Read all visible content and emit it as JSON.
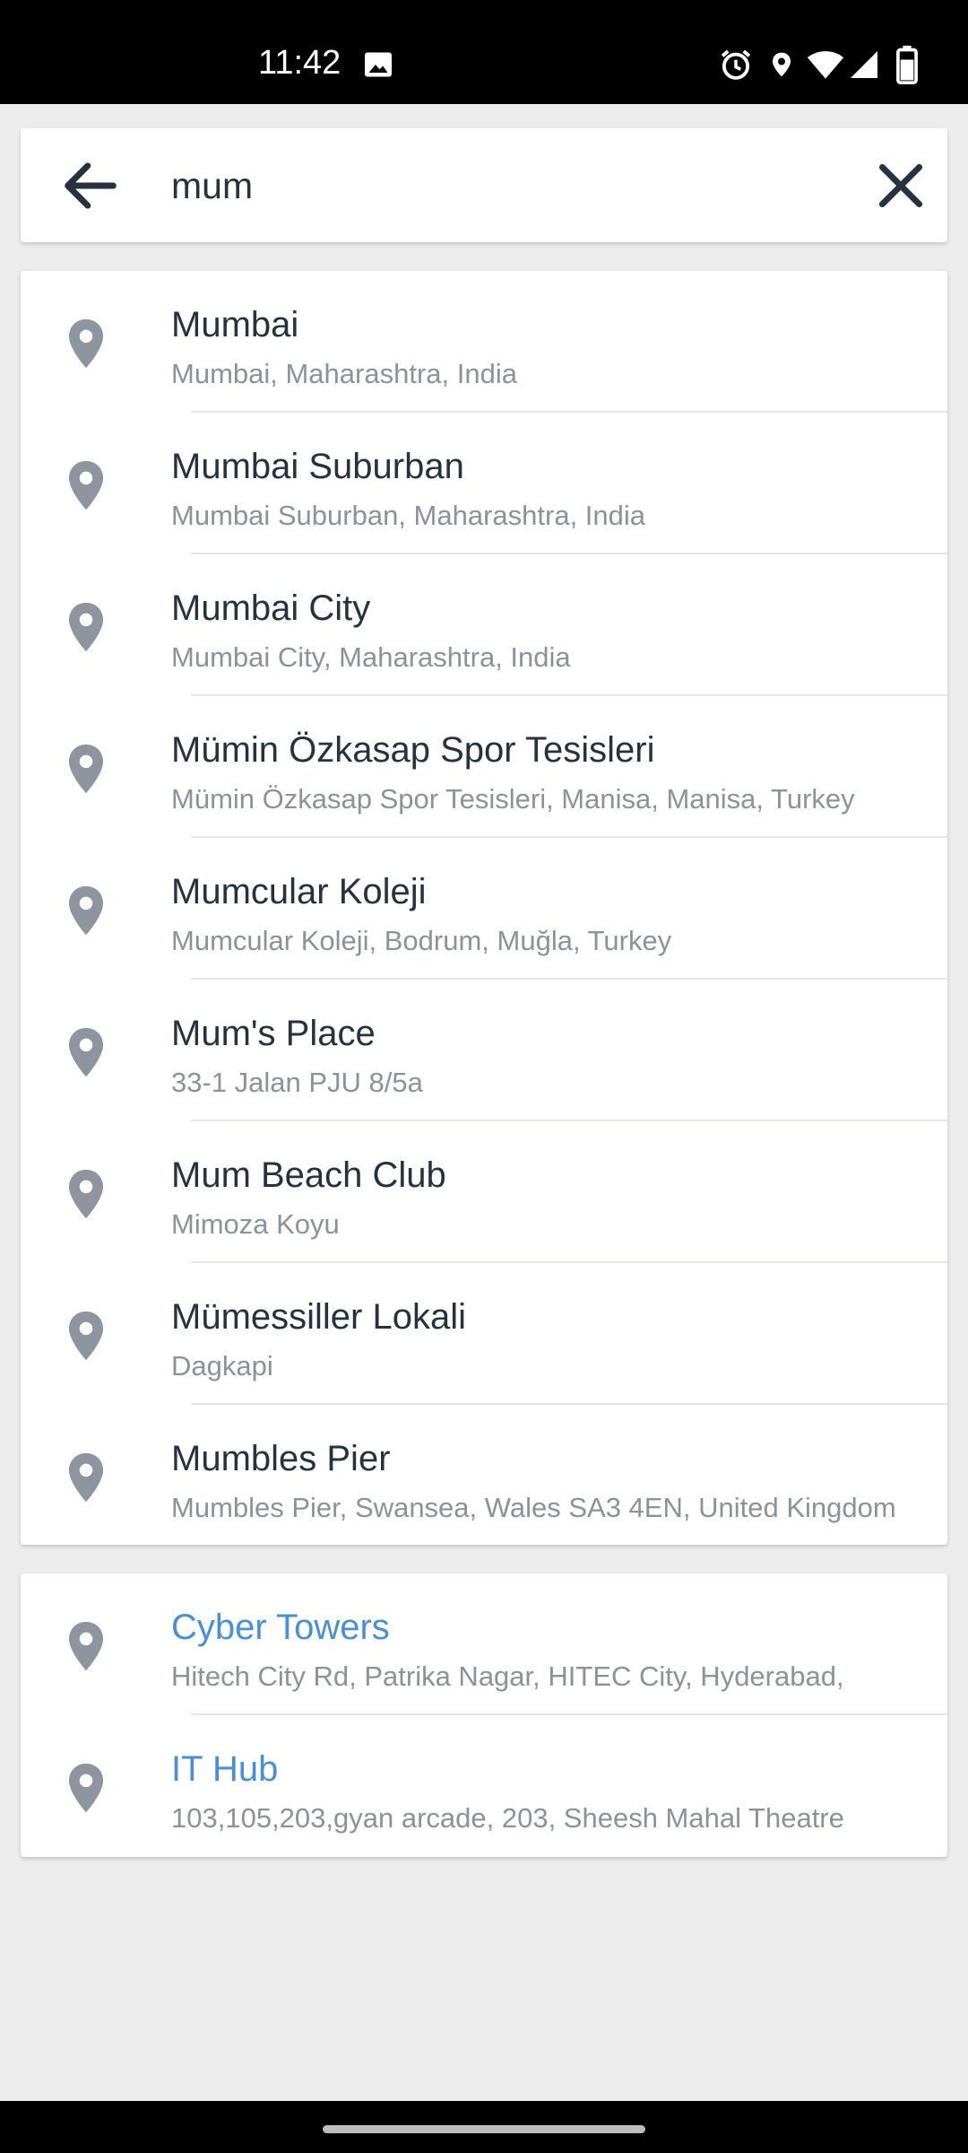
{
  "status_bar": {
    "time": "11:42",
    "icons": [
      "image-icon",
      "alarm-icon",
      "location-icon",
      "wifi-icon",
      "signal-icon",
      "battery-icon"
    ]
  },
  "search": {
    "value": "mum",
    "back_icon": "arrow-left-icon",
    "clear_icon": "close-icon"
  },
  "results": [
    {
      "title": "Mumbai",
      "subtitle": "Mumbai, Maharashtra, India"
    },
    {
      "title": "Mumbai Suburban",
      "subtitle": "Mumbai Suburban, Maharashtra, India"
    },
    {
      "title": "Mumbai City",
      "subtitle": "Mumbai City, Maharashtra, India"
    },
    {
      "title": "Mümin Özkasap Spor Tesisleri",
      "subtitle": "Mümin Özkasap Spor Tesisleri, Manisa, Manisa, Turkey"
    },
    {
      "title": "Mumcular Koleji",
      "subtitle": "Mumcular Koleji, Bodrum, Muğla, Turkey"
    },
    {
      "title": "Mum's Place",
      "subtitle": "33-1 Jalan PJU 8/5a"
    },
    {
      "title": "Mum Beach Club",
      "subtitle": "Mimoza Koyu"
    },
    {
      "title": "Mümessiller Lokali",
      "subtitle": "Dagkapi"
    },
    {
      "title": "Mumbles Pier",
      "subtitle": "Mumbles Pier, Swansea, Wales SA3 4EN, United Kingdom"
    }
  ],
  "recent": [
    {
      "title": "Cyber Towers",
      "subtitle": "Hitech City Rd, Patrika Nagar, HITEC City, Hyderabad,"
    },
    {
      "title": "IT Hub",
      "subtitle": "103,105,203,gyan arcade, 203, Sheesh Mahal Theatre"
    }
  ],
  "colors": {
    "text_primary": "#27323f",
    "text_secondary": "#8c929b",
    "link": "#4a8fd1",
    "pin": "#8e959e",
    "background": "#ececec"
  }
}
